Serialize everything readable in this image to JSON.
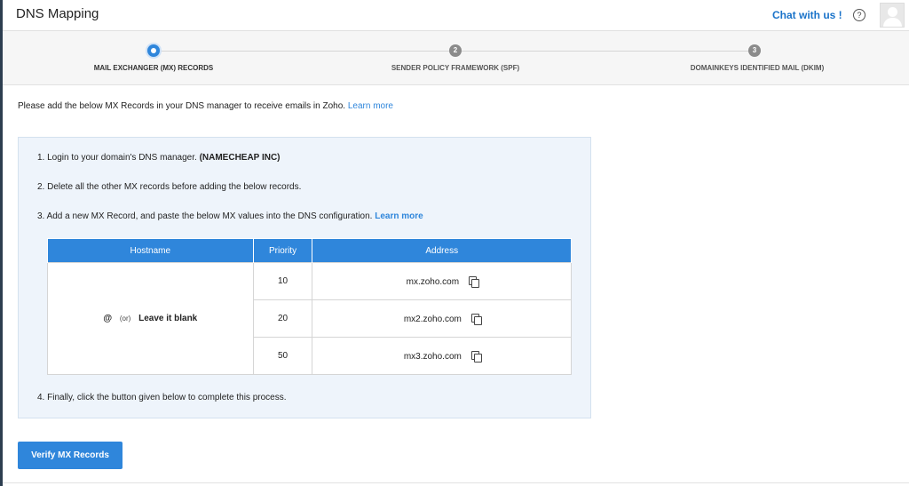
{
  "header": {
    "title": "DNS Mapping",
    "chat_label": "Chat with us !",
    "help_glyph": "?"
  },
  "steps": [
    {
      "number": "",
      "label": "MAIL EXCHANGER (MX) RECORDS",
      "active": true
    },
    {
      "number": "2",
      "label": "SENDER POLICY FRAMEWORK (SPF)",
      "active": false
    },
    {
      "number": "3",
      "label": "DOMAINKEYS IDENTIFIED MAIL (DKIM)",
      "active": false
    }
  ],
  "intro": {
    "text": "Please add the below MX Records in your DNS manager to receive emails in Zoho.",
    "link": "Learn more"
  },
  "instructions": {
    "step1_text": "1. Login to your domain's DNS manager.",
    "step1_bold": "(NAMECHEAP INC)",
    "step2_text": "2. Delete all the other MX records before adding the below records.",
    "step3_text": "3. Add a new MX Record, and paste the below MX values into the DNS configuration.",
    "step3_link": "Learn more",
    "step4_text": "4. Finally, click the button given below to complete this process."
  },
  "table": {
    "headers": [
      "Hostname",
      "Priority",
      "Address"
    ],
    "hostname": {
      "at": "@",
      "or": "(or)",
      "blank": "Leave it blank"
    },
    "rows": [
      {
        "priority": "10",
        "address": "mx.zoho.com"
      },
      {
        "priority": "20",
        "address": "mx2.zoho.com"
      },
      {
        "priority": "50",
        "address": "mx3.zoho.com"
      }
    ]
  },
  "verify_button": "Verify MX Records",
  "colors": {
    "accent": "#2f86db",
    "panel": "#eef4fb",
    "sidebar": "#2d3e50"
  }
}
